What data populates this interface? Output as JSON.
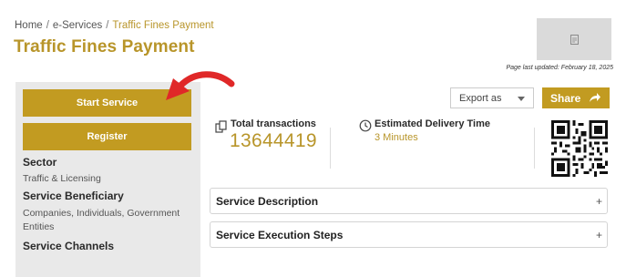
{
  "breadcrumb": {
    "home": "Home",
    "services": "e-Services",
    "current": "Traffic Fines Payment",
    "separator": "/"
  },
  "page_title": "Traffic Fines Payment",
  "last_updated": "Page last updated: February 18, 2025",
  "sidebar": {
    "start_label": "Start Service",
    "register_label": "Register",
    "sections": [
      {
        "heading": "Sector",
        "value": "Traffic & Licensing"
      },
      {
        "heading": "Service Beneficiary",
        "value": "Companies, Individuals, Government Entities"
      },
      {
        "heading": "Service Channels",
        "value": ""
      }
    ]
  },
  "toolbar": {
    "export_label": "Export as",
    "share_label": "Share"
  },
  "stats": {
    "transactions_label": "Total transactions",
    "transactions_value": "13644419",
    "delivery_label": "Estimated Delivery Time",
    "delivery_value": "3 Minutes"
  },
  "accordions": [
    {
      "title": "Service Description",
      "icon": "+"
    },
    {
      "title": "Service Execution Steps",
      "icon": "+"
    }
  ],
  "colors": {
    "accent": "#c29b21",
    "accent_text": "#b8952a",
    "sidebar_bg": "#e9e9e9",
    "arrow": "#e02828"
  }
}
